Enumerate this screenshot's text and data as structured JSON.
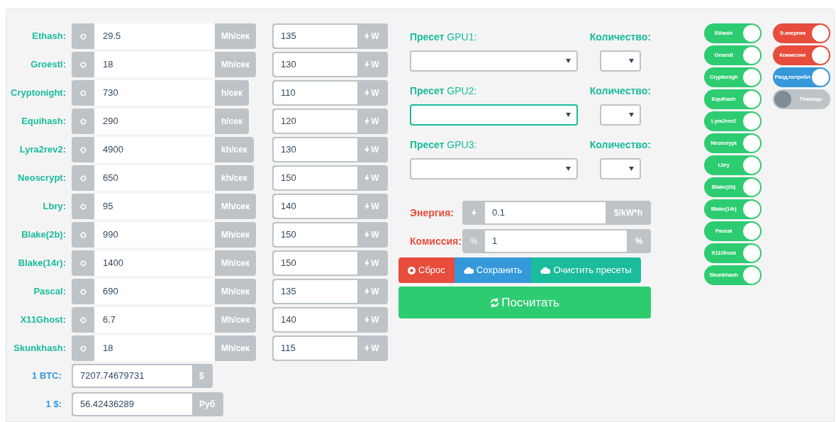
{
  "algorithms": [
    {
      "name": "Ethash:",
      "hashrate": "29.5",
      "unit": "Mh/сек",
      "power": "135",
      "power_unit": "W"
    },
    {
      "name": "Groestl:",
      "hashrate": "18",
      "unit": "Mh/сек",
      "power": "130",
      "power_unit": "W"
    },
    {
      "name": "Cryptonight:",
      "hashrate": "730",
      "unit": "h/сек",
      "power": "110",
      "power_unit": "W"
    },
    {
      "name": "Equihash:",
      "hashrate": "290",
      "unit": "h/сек",
      "power": "120",
      "power_unit": "W"
    },
    {
      "name": "Lyra2rev2:",
      "hashrate": "4900",
      "unit": "kh/сек",
      "power": "130",
      "power_unit": "W"
    },
    {
      "name": "Neoscrypt:",
      "hashrate": "650",
      "unit": "kh/сек",
      "power": "150",
      "power_unit": "W"
    },
    {
      "name": "Lbry:",
      "hashrate": "95",
      "unit": "Mh/сек",
      "power": "140",
      "power_unit": "W"
    },
    {
      "name": "Blake(2b):",
      "hashrate": "990",
      "unit": "Mh/сек",
      "power": "150",
      "power_unit": "W"
    },
    {
      "name": "Blake(14r):",
      "hashrate": "1400",
      "unit": "Mh/сек",
      "power": "150",
      "power_unit": "W"
    },
    {
      "name": "Pascal:",
      "hashrate": "690",
      "unit": "Mh/сек",
      "power": "135",
      "power_unit": "W"
    },
    {
      "name": "X11Ghost:",
      "hashrate": "6.7",
      "unit": "Mh/сек",
      "power": "140",
      "power_unit": "W"
    },
    {
      "name": "Skunkhash:",
      "hashrate": "18",
      "unit": "Mh/сек",
      "power": "115",
      "power_unit": "W"
    }
  ],
  "rates": [
    {
      "label": "1 BTC:",
      "value": "7207.74679731",
      "unit": "$"
    },
    {
      "label": "1 $:",
      "value": "56.42436289",
      "unit": "Руб"
    }
  ],
  "presets": [
    {
      "label": "**Пресет** GPU1:",
      "quantity_label": "Количество:",
      "focused": false
    },
    {
      "label": "**Пресет** GPU2:",
      "quantity_label": "Количество:",
      "focused": true
    },
    {
      "label": "**Пресет** GPU3:",
      "quantity_label": "Количество:",
      "focused": false
    }
  ],
  "costs": [
    {
      "kind": "energy",
      "label": "Энергия:",
      "value": "0.1",
      "unit": "$/kW*h"
    },
    {
      "kind": "commission",
      "label": "Комиссия:",
      "prefix": "%",
      "value": "1",
      "unit": "%"
    }
  ],
  "buttons": [
    {
      "kind": "reset",
      "label": "Сброс"
    },
    {
      "kind": "save",
      "label": "Сохранить"
    },
    {
      "kind": "clear",
      "label": "Очистить пресеты"
    }
  ],
  "calculate_button": "Посчитать",
  "algorithm_toggles": [
    {
      "label": "Ethash",
      "on": true,
      "color": "#2ecc71"
    },
    {
      "label": "Groestl",
      "on": true,
      "color": "#2ecc71"
    },
    {
      "label": "Cryptonigh",
      "on": true,
      "color": "#2ecc71"
    },
    {
      "label": "Equihash",
      "on": true,
      "color": "#2ecc71"
    },
    {
      "label": "Lyra2rev2",
      "on": true,
      "color": "#2ecc71"
    },
    {
      "label": "Neoscrypt",
      "on": true,
      "color": "#2ecc71"
    },
    {
      "label": "Lbry",
      "on": true,
      "color": "#2ecc71"
    },
    {
      "label": "Blake(2b)",
      "on": true,
      "color": "#2ecc71"
    },
    {
      "label": "Blake(14r)",
      "on": true,
      "color": "#2ecc71"
    },
    {
      "label": "Pascal",
      "on": true,
      "color": "#2ecc71"
    },
    {
      "label": "X11Ghost",
      "on": true,
      "color": "#2ecc71"
    },
    {
      "label": "Skunkhash",
      "on": true,
      "color": "#2ecc71"
    }
  ],
  "setting_toggles": [
    {
      "label": "Э.энергия",
      "on": true,
      "color": "#e74c3c"
    },
    {
      "label": "Комиссия",
      "on": true,
      "color": "#e74c3c"
    },
    {
      "label": "Разд.потребл",
      "on": true,
      "color": "#3498db"
    },
    {
      "label": "Помощь",
      "on": false,
      "color": "#bdc3c7"
    }
  ]
}
